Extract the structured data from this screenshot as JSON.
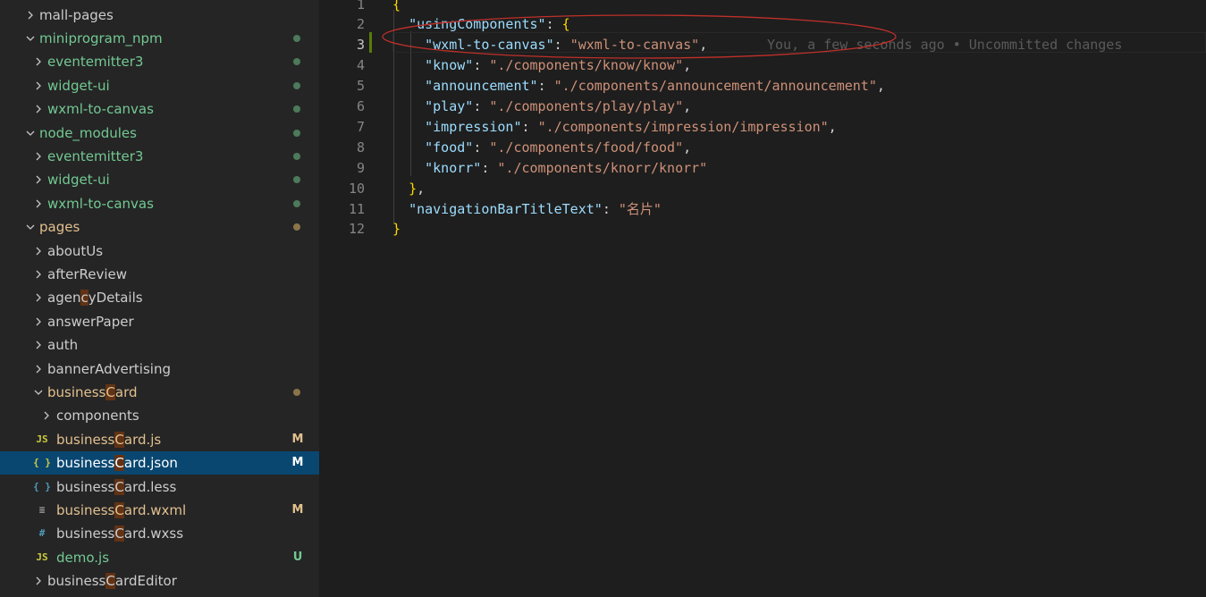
{
  "explorer": {
    "items": [
      {
        "label": "mall-pages",
        "kind": "folder",
        "open": false,
        "depth": 0,
        "color": "white"
      },
      {
        "label": "miniprogram_npm",
        "kind": "folder",
        "open": true,
        "depth": 0,
        "color": "green",
        "status": "dot"
      },
      {
        "label": "eventemitter3",
        "kind": "folder",
        "open": false,
        "depth": 1,
        "color": "green",
        "status": "dot"
      },
      {
        "label": "widget-ui",
        "kind": "folder",
        "open": false,
        "depth": 1,
        "color": "green",
        "status": "dot"
      },
      {
        "label": "wxml-to-canvas",
        "kind": "folder",
        "open": false,
        "depth": 1,
        "color": "green",
        "status": "dot"
      },
      {
        "label": "node_modules",
        "kind": "folder",
        "open": true,
        "depth": 0,
        "color": "green",
        "status": "dot"
      },
      {
        "label": "eventemitter3",
        "kind": "folder",
        "open": false,
        "depth": 1,
        "color": "green",
        "status": "dot"
      },
      {
        "label": "widget-ui",
        "kind": "folder",
        "open": false,
        "depth": 1,
        "color": "green",
        "status": "dot"
      },
      {
        "label": "wxml-to-canvas",
        "kind": "folder",
        "open": false,
        "depth": 1,
        "color": "green",
        "status": "dot"
      },
      {
        "label": "pages",
        "kind": "folder",
        "open": true,
        "depth": 0,
        "color": "yellow",
        "status": "dot"
      },
      {
        "label": "aboutUs",
        "kind": "folder",
        "open": false,
        "depth": 1,
        "color": "white"
      },
      {
        "label": "afterReview",
        "kind": "folder",
        "open": false,
        "depth": 1,
        "color": "white"
      },
      {
        "label": "agencyDetails",
        "kind": "folder",
        "open": false,
        "depth": 1,
        "color": "white",
        "hl": [
          "agen",
          "c",
          "yDetails"
        ]
      },
      {
        "label": "answerPaper",
        "kind": "folder",
        "open": false,
        "depth": 1,
        "color": "white"
      },
      {
        "label": "auth",
        "kind": "folder",
        "open": false,
        "depth": 1,
        "color": "white"
      },
      {
        "label": "bannerAdvertising",
        "kind": "folder",
        "open": false,
        "depth": 1,
        "color": "white"
      },
      {
        "label": "businessCard",
        "kind": "folder",
        "open": true,
        "depth": 1,
        "color": "yellow",
        "status": "dot",
        "hl": [
          "business",
          "C",
          "ard"
        ]
      },
      {
        "label": "components",
        "kind": "folder",
        "open": false,
        "depth": 2,
        "color": "white"
      },
      {
        "label": "businessCard.js",
        "kind": "js",
        "depth": 2,
        "color": "yellow",
        "status": "M",
        "hl": [
          "business",
          "C",
          "ard.js"
        ]
      },
      {
        "label": "businessCard.json",
        "kind": "json",
        "depth": 2,
        "color": "white",
        "status": "M",
        "selected": true,
        "hl": [
          "business",
          "C",
          "ard.json"
        ]
      },
      {
        "label": "businessCard.less",
        "kind": "less",
        "depth": 2,
        "color": "white",
        "hl": [
          "business",
          "C",
          "ard.less"
        ]
      },
      {
        "label": "businessCard.wxml",
        "kind": "wxml",
        "depth": 2,
        "color": "yellow",
        "status": "M",
        "hl": [
          "business",
          "C",
          "ard.wxml"
        ]
      },
      {
        "label": "businessCard.wxss",
        "kind": "wxss",
        "depth": 2,
        "color": "white",
        "hl": [
          "business",
          "C",
          "ard.wxss"
        ]
      },
      {
        "label": "demo.js",
        "kind": "js",
        "depth": 2,
        "color": "green",
        "status": "U"
      },
      {
        "label": "businessCardEditor",
        "kind": "folder",
        "open": false,
        "depth": 1,
        "color": "white",
        "hl": [
          "business",
          "C",
          "ardEditor"
        ]
      }
    ]
  },
  "editor": {
    "first_line_number": "1",
    "lines": [
      {
        "n": "2",
        "tokens": [
          {
            "t": "  ",
            "c": "p"
          },
          {
            "t": "\"usingComponents\"",
            "c": "k"
          },
          {
            "t": ": ",
            "c": "p"
          },
          {
            "t": "{",
            "c": "b"
          }
        ]
      },
      {
        "n": "3",
        "tokens": [
          {
            "t": "    ",
            "c": "p"
          },
          {
            "t": "\"wxml-to-canvas\"",
            "c": "k"
          },
          {
            "t": ": ",
            "c": "p"
          },
          {
            "t": "\"wxml-to-canvas\"",
            "c": "s"
          },
          {
            "t": ",",
            "c": "p"
          }
        ],
        "current": true,
        "blame": "You, a few seconds ago • Uncommitted changes"
      },
      {
        "n": "4",
        "tokens": [
          {
            "t": "    ",
            "c": "p"
          },
          {
            "t": "\"know\"",
            "c": "k"
          },
          {
            "t": ": ",
            "c": "p"
          },
          {
            "t": "\"./components/know/know\"",
            "c": "s"
          },
          {
            "t": ",",
            "c": "p"
          }
        ]
      },
      {
        "n": "5",
        "tokens": [
          {
            "t": "    ",
            "c": "p"
          },
          {
            "t": "\"announcement\"",
            "c": "k"
          },
          {
            "t": ": ",
            "c": "p"
          },
          {
            "t": "\"./components/announcement/announcement\"",
            "c": "s"
          },
          {
            "t": ",",
            "c": "p"
          }
        ]
      },
      {
        "n": "6",
        "tokens": [
          {
            "t": "    ",
            "c": "p"
          },
          {
            "t": "\"play\"",
            "c": "k"
          },
          {
            "t": ": ",
            "c": "p"
          },
          {
            "t": "\"./components/play/play\"",
            "c": "s"
          },
          {
            "t": ",",
            "c": "p"
          }
        ]
      },
      {
        "n": "7",
        "tokens": [
          {
            "t": "    ",
            "c": "p"
          },
          {
            "t": "\"impression\"",
            "c": "k"
          },
          {
            "t": ": ",
            "c": "p"
          },
          {
            "t": "\"./components/impression/impression\"",
            "c": "s"
          },
          {
            "t": ",",
            "c": "p"
          }
        ]
      },
      {
        "n": "8",
        "tokens": [
          {
            "t": "    ",
            "c": "p"
          },
          {
            "t": "\"food\"",
            "c": "k"
          },
          {
            "t": ": ",
            "c": "p"
          },
          {
            "t": "\"./components/food/food\"",
            "c": "s"
          },
          {
            "t": ",",
            "c": "p"
          }
        ]
      },
      {
        "n": "9",
        "tokens": [
          {
            "t": "    ",
            "c": "p"
          },
          {
            "t": "\"knorr\"",
            "c": "k"
          },
          {
            "t": ": ",
            "c": "p"
          },
          {
            "t": "\"./components/knorr/knorr\"",
            "c": "s"
          }
        ]
      },
      {
        "n": "10",
        "tokens": [
          {
            "t": "  ",
            "c": "p"
          },
          {
            "t": "}",
            "c": "b"
          },
          {
            "t": ",",
            "c": "p"
          }
        ]
      },
      {
        "n": "11",
        "tokens": [
          {
            "t": "  ",
            "c": "p"
          },
          {
            "t": "\"navigationBarTitleText\"",
            "c": "k"
          },
          {
            "t": ": ",
            "c": "p"
          },
          {
            "t": "\"名片\"",
            "c": "s"
          }
        ]
      },
      {
        "n": "12",
        "tokens": [
          {
            "t": "}",
            "c": "b"
          }
        ]
      }
    ],
    "first_line_tokens": [
      {
        "t": "{",
        "c": "b"
      }
    ]
  },
  "colors": {
    "sidebar_bg": "#252526",
    "editor_bg": "#1e1e1e",
    "selection": "#094771",
    "git_added": "#73c991",
    "git_modified": "#e2c08d",
    "annotation_ellipse": "#c0302a"
  }
}
